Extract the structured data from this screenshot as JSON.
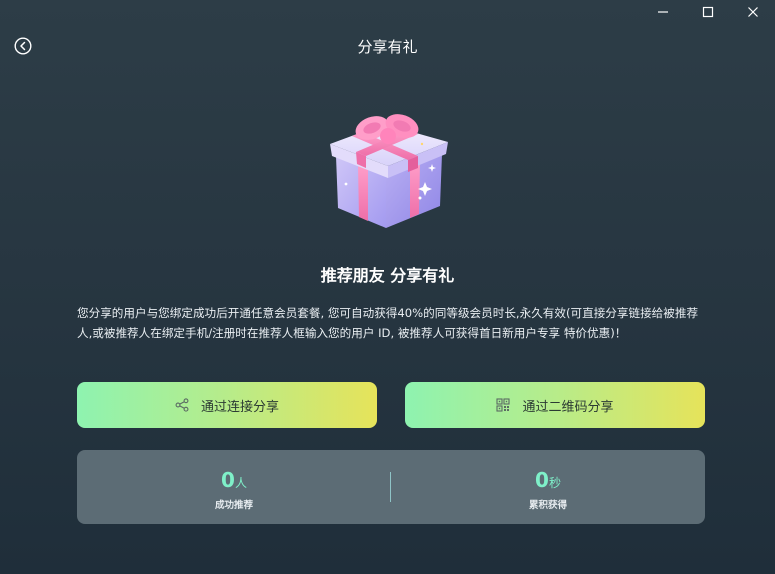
{
  "window": {
    "controls": [
      "minimize-icon",
      "maximize-icon",
      "close-icon"
    ]
  },
  "header": {
    "title": "分享有礼",
    "back_icon": "back-arrow-circle-icon"
  },
  "hero": {
    "image": "gift-box-illustration",
    "headline": "推荐朋友 分享有礼"
  },
  "description": "您分享的用户与您绑定成功后开通任意会员套餐, 您可自动获得40%的同等级会员时长,永久有效(可直接分享链接给被推荐人,或被推荐人在绑定手机/注册时在推荐人框输入您的用户 ID, 被推荐人可获得首日新用户专享 特价优惠)！",
  "actions": {
    "share_link": {
      "label": "通过连接分享",
      "icon": "share-icon"
    },
    "share_qr": {
      "label": "通过二维码分享",
      "icon": "qr-code-icon"
    }
  },
  "stats": {
    "referrals": {
      "value": "0",
      "unit": "人",
      "label": "成功推荐"
    },
    "earned": {
      "value": "0",
      "unit": "秒",
      "label": "累积获得"
    }
  },
  "colors": {
    "accent_green": "#8ef3b0",
    "accent_yellow": "#e6e35a",
    "stat_value": "#7ff0c9",
    "background": "#263540"
  }
}
